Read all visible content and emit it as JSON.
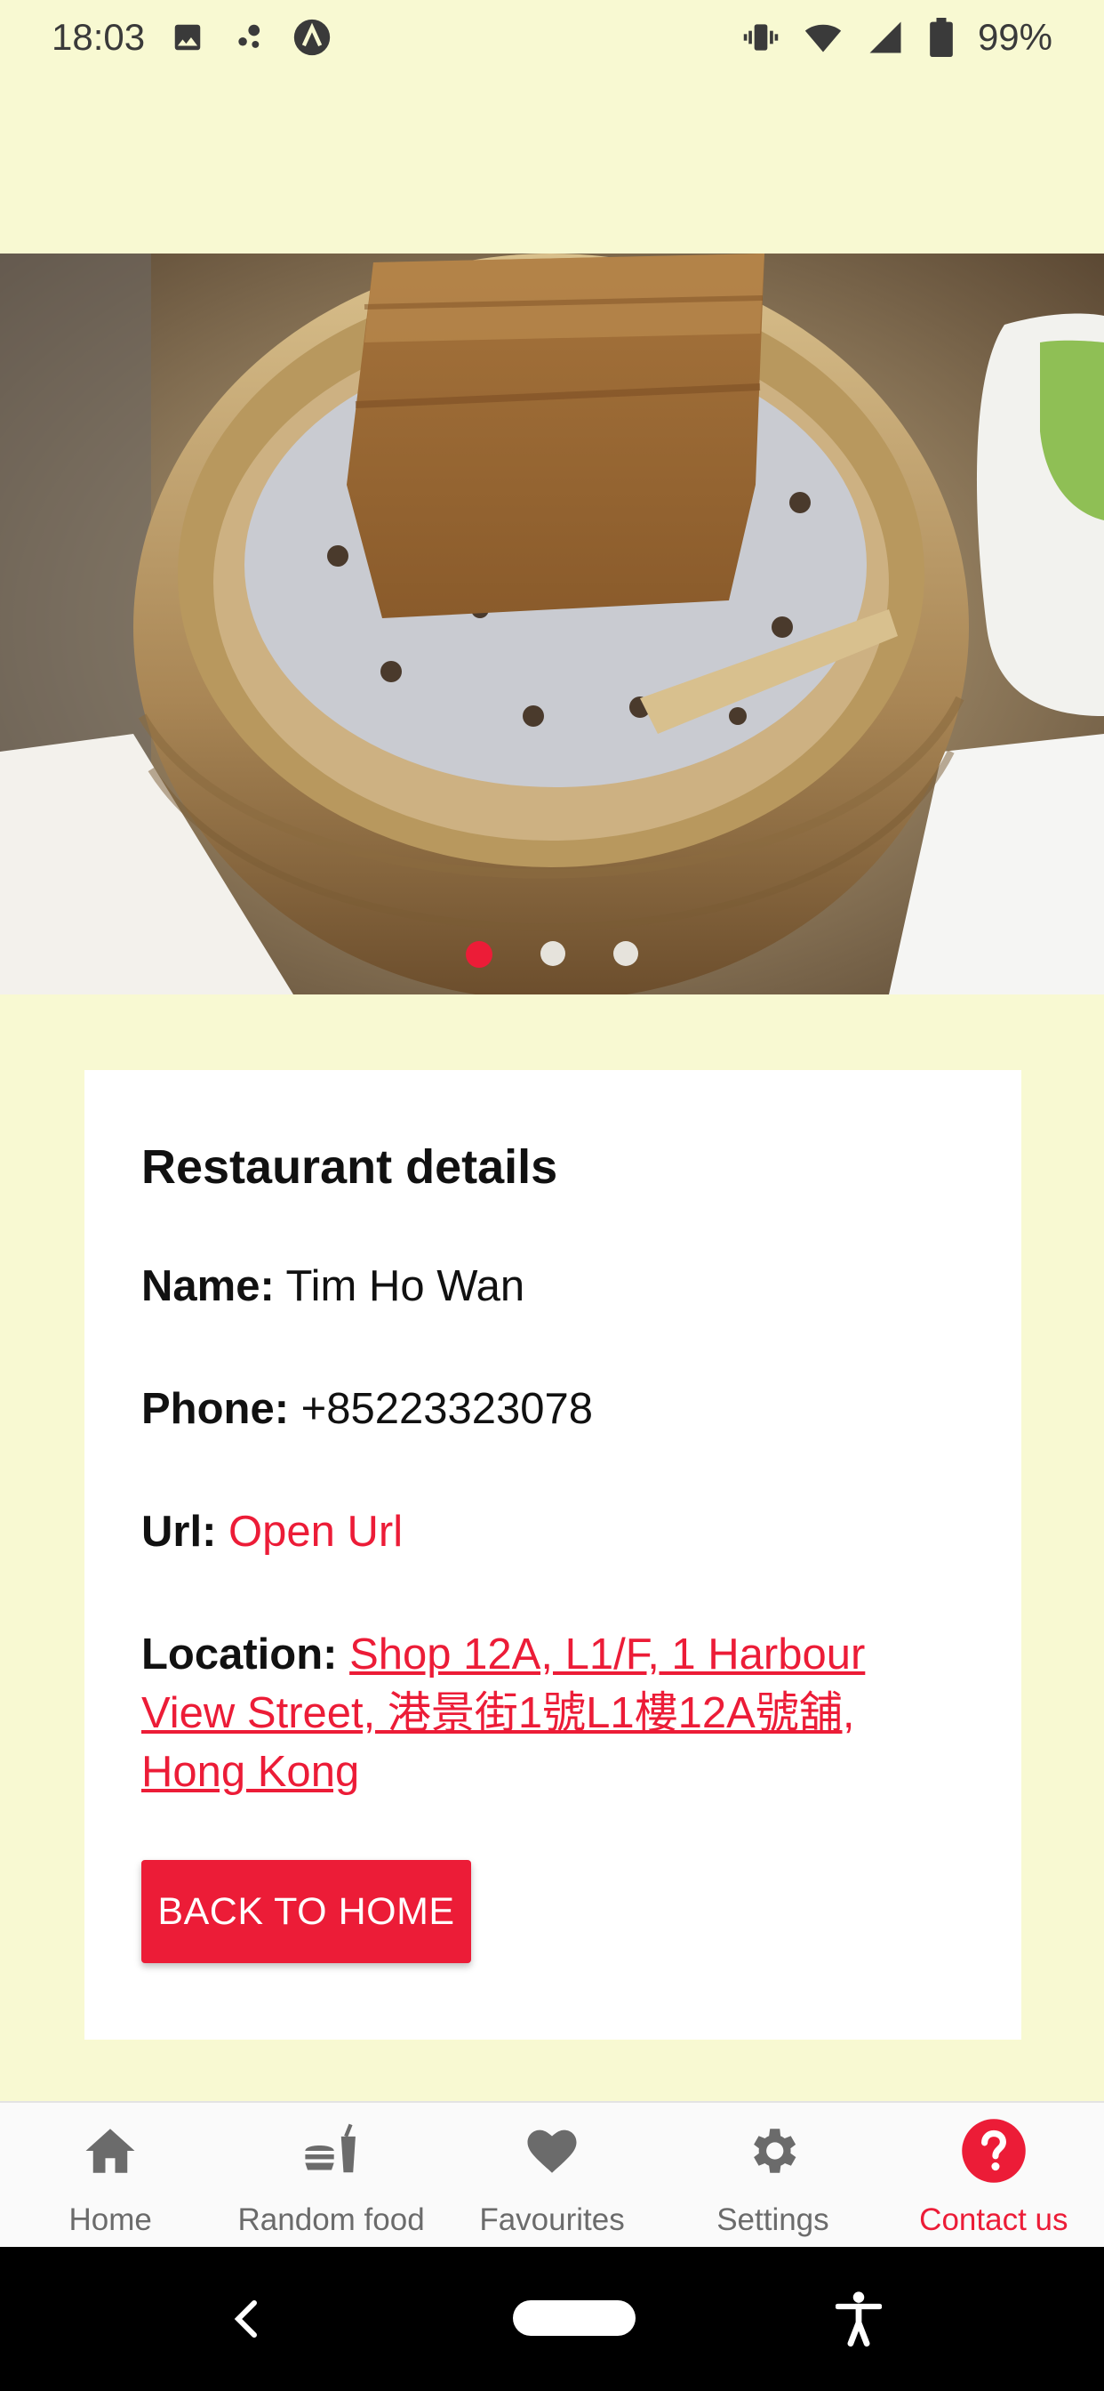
{
  "status_bar": {
    "time": "18:03",
    "battery": "99%",
    "icons_left": [
      "image-icon",
      "dots-icon",
      "app-icon"
    ],
    "icons_right": [
      "vibrate-icon",
      "wifi-icon",
      "signal-icon",
      "battery-icon"
    ]
  },
  "carousel": {
    "slide_count": 3,
    "active_index": 0,
    "active_color": "#ec1c37"
  },
  "details": {
    "title": "Restaurant details",
    "name_label": "Name:",
    "name_value": "Tim Ho Wan",
    "phone_label": "Phone:",
    "phone_value": "+85223323078",
    "url_label": "Url:",
    "url_value": "Open Url",
    "location_label": "Location:",
    "location_value": "Shop 12A, L1/F, 1 Harbour View Street, 港景街1號L1樓12A號舖, Hong Kong",
    "back_button": "BACK TO HOME"
  },
  "tabs": [
    {
      "label": "Home",
      "icon": "home-icon",
      "active": false
    },
    {
      "label": "Random food",
      "icon": "fast-food-icon",
      "active": false
    },
    {
      "label": "Favourites",
      "icon": "heart-icon",
      "active": false
    },
    {
      "label": "Settings",
      "icon": "gear-icon",
      "active": false
    },
    {
      "label": "Contact us",
      "icon": "help-icon",
      "active": true
    }
  ],
  "colors": {
    "background": "#f8f9d2",
    "accent": "#ec1c37",
    "tab_inactive": "#6b6b6b"
  }
}
